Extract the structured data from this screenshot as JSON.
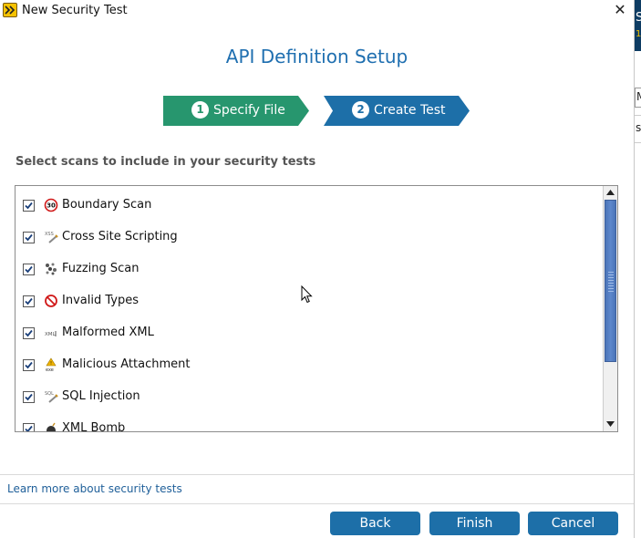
{
  "window": {
    "title": "New Security Test",
    "close_symbol": "✕"
  },
  "background_window": {
    "letter_top": "S",
    "letter_small": "1",
    "box_letter": "M",
    "partial_text": "sa"
  },
  "heading": "API Definition Setup",
  "steps": [
    {
      "number": "1",
      "label": "Specify File",
      "state": "completed",
      "color": "#27966e"
    },
    {
      "number": "2",
      "label": "Create Test",
      "state": "current",
      "color": "#1d6fa8"
    }
  ],
  "section_label": "Select scans to include in your security tests",
  "scans": [
    {
      "label": "Boundary Scan",
      "checked": true,
      "icon": "boundary-scan-icon",
      "icon_text": "30"
    },
    {
      "label": "Cross Site Scripting",
      "checked": true,
      "icon": "xss-icon",
      "icon_text": "XSS"
    },
    {
      "label": "Fuzzing Scan",
      "checked": true,
      "icon": "fuzzing-icon"
    },
    {
      "label": "Invalid Types",
      "checked": true,
      "icon": "invalid-types-icon"
    },
    {
      "label": "Malformed XML",
      "checked": true,
      "icon": "malformed-xml-icon",
      "icon_text": "XML"
    },
    {
      "label": "Malicious Attachment",
      "checked": true,
      "icon": "malicious-attachment-icon",
      "icon_text": "exe"
    },
    {
      "label": "SQL Injection",
      "checked": true,
      "icon": "sql-injection-icon",
      "icon_text": "SQL"
    },
    {
      "label": "XML Bomb",
      "checked": true,
      "icon": "xml-bomb-icon"
    }
  ],
  "learn_more_link": "Learn more about security tests",
  "buttons": {
    "back": "Back",
    "finish": "Finish",
    "cancel": "Cancel"
  },
  "colors": {
    "accent": "#1d6fa8",
    "step_done": "#27966e",
    "heading": "#1f6fb0"
  }
}
